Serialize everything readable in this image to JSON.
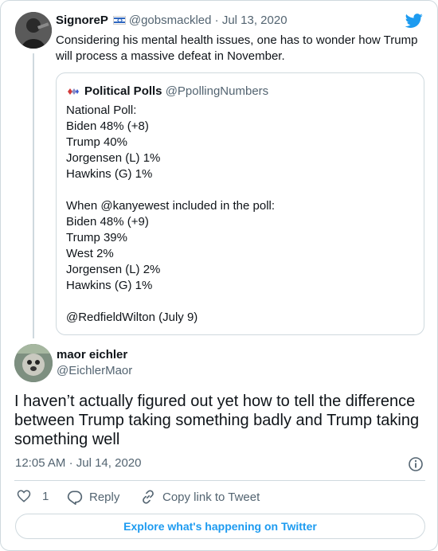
{
  "tweet1": {
    "name": "SignoreP",
    "handle": "@gobsmackled",
    "date_sep": "·",
    "date": "Jul 13, 2020",
    "text": "Considering his mental health issues, one has to wonder how Trump will process a massive defeat in November."
  },
  "quoted": {
    "name": "Political Polls",
    "handle": "@PpollingNumbers",
    "lines": [
      "National Poll:",
      "Biden 48% (+8)",
      "Trump 40%",
      "Jorgensen (L) 1%",
      "Hawkins (G) 1%",
      "",
      "When @kanyewest included in the poll:",
      "Biden 48% (+9)",
      "Trump 39%",
      "West 2%",
      "Jorgensen (L) 2%",
      "Hawkins (G) 1%",
      "",
      "@RedfieldWilton (July 9)"
    ]
  },
  "tweet2": {
    "name": "maor eichler",
    "handle": "@EichlerMaor",
    "text": "I haven’t actually figured out yet how to tell the difference between Trump taking something badly and Trump taking something well",
    "time": "12:05 AM",
    "date_sep": "·",
    "date": "Jul 14, 2020"
  },
  "actions": {
    "like_count": "1",
    "reply_label": "Reply",
    "copy_label": "Copy link to Tweet"
  },
  "explore_label": "Explore what's happening on Twitter",
  "colors": {
    "accent": "#1d9bf0",
    "secondary_text": "#536471",
    "border": "#cfd9de"
  },
  "icons": [
    "twitter-bird-icon",
    "israel-flag-icon",
    "political-polls-logo-icon",
    "info-icon",
    "heart-icon",
    "reply-icon",
    "link-icon"
  ]
}
